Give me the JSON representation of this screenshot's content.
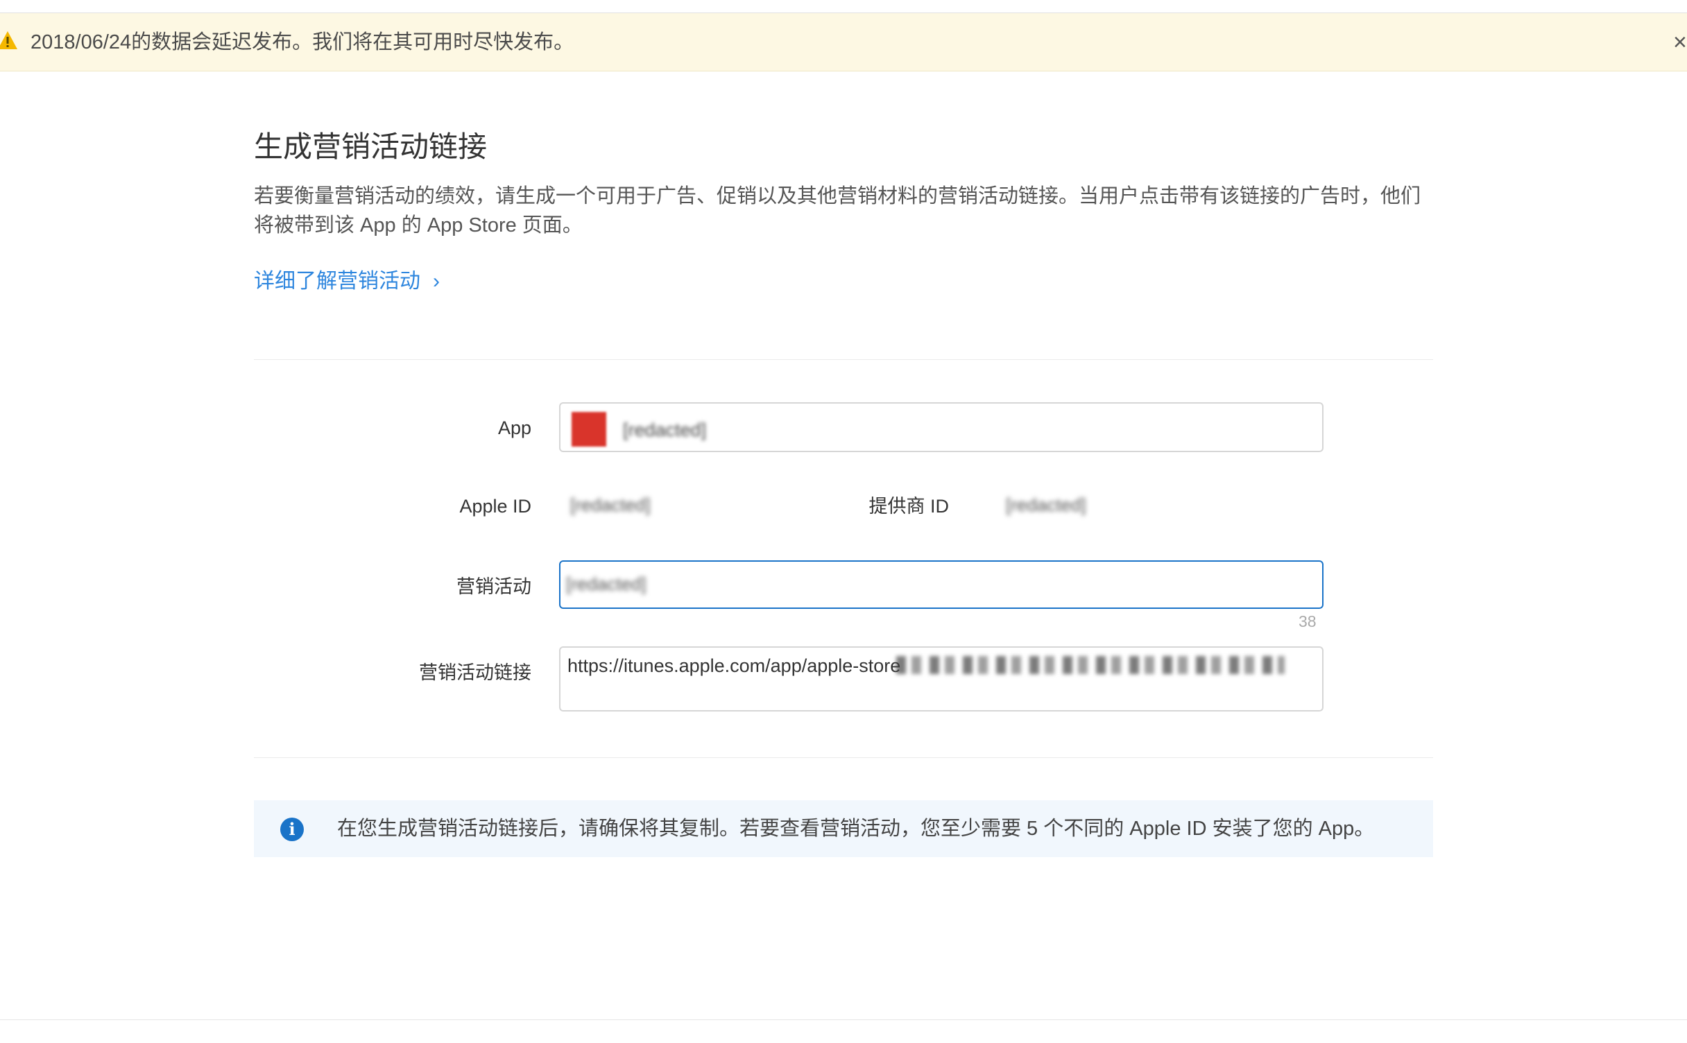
{
  "banner": {
    "text": "2018/06/24的数据会延迟发布。我们将在其可用时尽快发布。",
    "close_symbol": "×"
  },
  "page": {
    "title": "生成营销活动链接",
    "description": "若要衡量营销活动的绩效，请生成一个可用于广告、促销以及其他营销材料的营销活动链接。当用户点击带有该链接的广告时，他们将被带到该 App 的 App Store 页面。",
    "learn_more": "详细了解营销活动",
    "learn_more_chevron": "›"
  },
  "form": {
    "app_label": "App",
    "app_value": "[redacted]",
    "apple_id_label": "Apple ID",
    "apple_id_value": "[redacted]",
    "provider_id_label": "提供商 ID",
    "provider_id_value": "[redacted]",
    "campaign_label": "营销活动",
    "campaign_value": "[redacted]",
    "campaign_counter": "38",
    "link_label": "营销活动链接",
    "link_value": "https://itunes.apple.com/app/apple-store"
  },
  "info": {
    "text": "在您生成营销活动链接后，请确保将其复制。若要查看营销活动，您至少需要 5 个不同的 Apple ID 安装了您的 App。"
  },
  "colors": {
    "accent": "#1a73c8",
    "link": "#2e86de",
    "banner_bg": "#fdf8e3",
    "warning": "#f5b800"
  },
  "icons": {
    "warning": "warning-icon",
    "info": "info-icon",
    "close": "close-icon",
    "chevron": "chevron-right-icon"
  }
}
